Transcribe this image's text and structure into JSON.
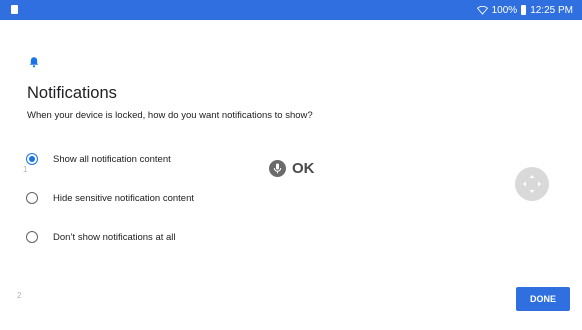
{
  "status_bar": {
    "battery": "100%",
    "time": "12:25 PM",
    "color": "#2f6fe0"
  },
  "screen": {
    "icon": "bell-icon",
    "title": "Notifications",
    "subtitle": "When your device is locked, how do you want notifications to show?"
  },
  "options": [
    {
      "label": "Show all notification content",
      "selected": true
    },
    {
      "label": "Hide sensitive notification content",
      "selected": false
    },
    {
      "label": "Don’t show notifications at all",
      "selected": false
    }
  ],
  "overlay": {
    "ok_label": "OK",
    "mic_icon": "mic-icon"
  },
  "side_numbers": [
    "1",
    "2"
  ],
  "actions": {
    "done_label": "DONE",
    "accent": "#1a73e8"
  }
}
